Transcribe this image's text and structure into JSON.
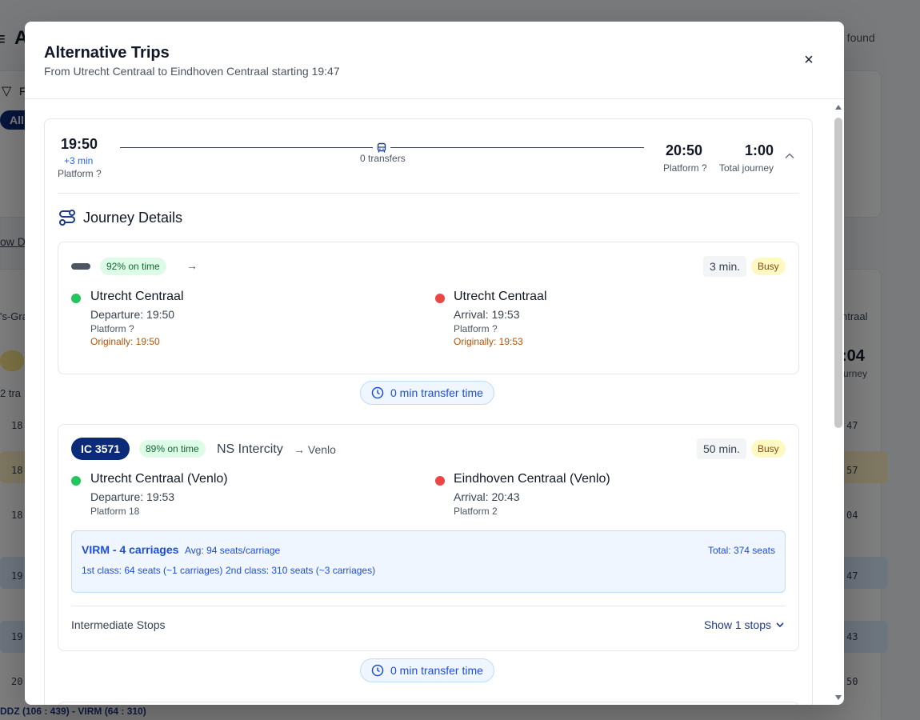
{
  "background": {
    "title_fragment": "A",
    "trips_found": "ps found",
    "filter_fragment": "F",
    "all_chip": "All",
    "show_link_fragment": "ow D",
    "station_fragment": "'s-Gra",
    "transfers_fragment": "2 tra",
    "right_station_fragment": "ntraal",
    "right_time_fragment": ":04",
    "right_label_fragment": "urney",
    "left_times": [
      "18:",
      "18:",
      "18:",
      "19:",
      "19:",
      "20:"
    ],
    "right_times": [
      "47",
      "57",
      "04",
      "47",
      "43",
      "50"
    ],
    "footer_text": "DDZ (106 : 439) - VIRM (64 : 310)"
  },
  "modal": {
    "title": "Alternative Trips",
    "subtitle": "From Utrecht Centraal to Eindhoven Centraal starting 19:47",
    "close_symbol": "×"
  },
  "trip": {
    "departure_time": "19:50",
    "delay": "+3 min",
    "departure_platform": "Platform ?",
    "transfers": "0 transfers",
    "arrival_time": "20:50",
    "arrival_platform": "Platform ?",
    "duration": "1:00",
    "duration_label": "Total journey",
    "journey_details_title": "Journey Details"
  },
  "leg1": {
    "on_time": "92% on time",
    "arrow": "→",
    "minutes": "3 min.",
    "crowding": "Busy",
    "from": {
      "station": "Utrecht Centraal",
      "time_line": "Departure: 19:50",
      "platform": "Platform ?",
      "original": "Originally: 19:50"
    },
    "to": {
      "station": "Utrecht Centraal",
      "time_line": "Arrival: 19:53",
      "platform": "Platform ?",
      "original": "Originally: 19:53"
    }
  },
  "transfer1": "0 min transfer time",
  "leg2": {
    "badge": "IC 3571",
    "on_time": "89% on time",
    "carrier": "NS Intercity",
    "destination": "→ Venlo",
    "minutes": "50 min.",
    "crowding": "Busy",
    "from": {
      "station": "Utrecht Centraal (Venlo)",
      "time_line": "Departure: 19:53",
      "platform": "Platform 18"
    },
    "to": {
      "station": "Eindhoven Centraal (Venlo)",
      "time_line": "Arrival: 20:43",
      "platform": "Platform 2"
    },
    "material": {
      "name": "VIRM - 4 carriages",
      "avg": "Avg: 94 seats/carriage",
      "total": "Total: 374 seats",
      "first_class": "1st class: 64 seats (~1 carriages)",
      "second_class": "2nd class: 310 seats (~3 carriages)"
    },
    "intermediate_label": "Intermediate Stops",
    "show_stops": "Show 1 stops"
  },
  "transfer2": "0 min transfer time",
  "colors": {
    "brand_navy": "#0b2a7a",
    "accent_blue": "#1d4ed8",
    "on_time_bg": "#dcfce7",
    "busy_bg": "#fef9c3",
    "departure_dot": "#22c55e",
    "arrival_dot": "#ef4444",
    "original_time": "#b45309"
  },
  "icons": [
    "close-icon",
    "train-icon",
    "chevron-up-icon",
    "route-icon",
    "clock-icon",
    "chevron-down-icon",
    "menu-icon",
    "filter-icon"
  ]
}
